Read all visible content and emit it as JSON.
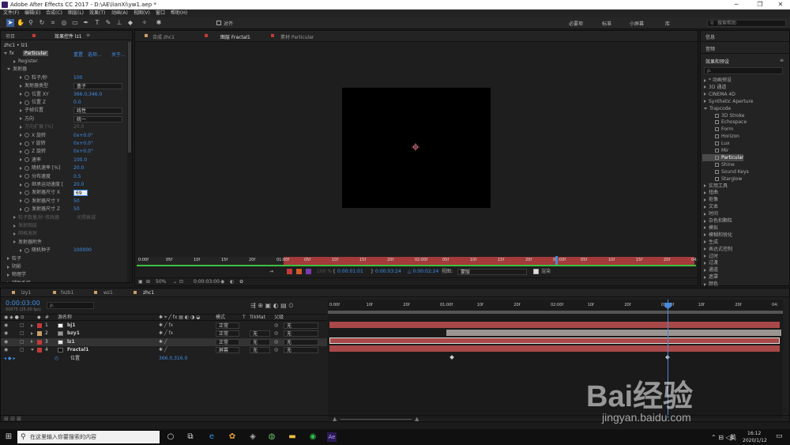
{
  "window": {
    "title": "Adobe After Effects CC 2017 - D:\\AE\\lianXi\\yw1.aep *",
    "min": "─",
    "max": "❐",
    "close": "✕"
  },
  "menu": [
    "文件(F)",
    "编辑(E)",
    "合成(C)",
    "图层(L)",
    "效果(T)",
    "动画(A)",
    "视图(V)",
    "窗口",
    "帮助(H)"
  ],
  "toolbar": {
    "align_label": "对齐",
    "workspaces": [
      "必要项",
      "标准",
      "小屏幕",
      "库"
    ],
    "search_placeholder": "搜索帮助"
  },
  "left_panel": {
    "tabs": [
      "项目",
      "效果控件 lz1"
    ],
    "breadcrumb": "zhc1 • lz1",
    "effect_name": "Particular",
    "effect_links": [
      "重置",
      "选项...",
      "关于..."
    ],
    "rows": [
      {
        "label": "Register",
        "val": "",
        "indent": 2,
        "dis": false
      },
      {
        "label": "发射器",
        "val": "",
        "indent": 1,
        "dis": false,
        "open": true
      },
      {
        "label": "粒子/秒",
        "val": "100",
        "indent": 3,
        "dis": false,
        "sw": true
      },
      {
        "label": "发射器类型",
        "val": "",
        "dd": "盒子",
        "indent": 3,
        "dis": false
      },
      {
        "label": "位置 XY",
        "val": "366.0,346.0",
        "indent": 3,
        "dis": false,
        "sw": true
      },
      {
        "label": "位置 Z",
        "val": "0.0",
        "indent": 3,
        "dis": false,
        "sw": true
      },
      {
        "label": "子帧位置",
        "val": "",
        "dd": "线性",
        "indent": 3,
        "dis": false
      },
      {
        "label": "方向",
        "val": "",
        "dd": "统一",
        "indent": 3,
        "dis": false
      },
      {
        "label": "方向扩展 [%]",
        "val": "20.0",
        "indent": 3,
        "dis": true
      },
      {
        "label": "X 旋转",
        "val": "0x+0.0°",
        "indent": 3,
        "dis": false,
        "sw": true
      },
      {
        "label": "Y 旋转",
        "val": "0x+0.0°",
        "indent": 3,
        "dis": false,
        "sw": true
      },
      {
        "label": "Z 旋转",
        "val": "0x+0.0°",
        "indent": 3,
        "dis": false,
        "sw": true
      },
      {
        "label": "速率",
        "val": "100.0",
        "indent": 3,
        "dis": false,
        "sw": true
      },
      {
        "label": "随机速率 [%]",
        "val": "20.0",
        "indent": 3,
        "dis": false,
        "sw": true
      },
      {
        "label": "分布速度",
        "val": "0.5",
        "indent": 3,
        "dis": false,
        "sw": true
      },
      {
        "label": "继承运动速度 [",
        "val": "20.0",
        "indent": 3,
        "dis": false,
        "sw": true
      },
      {
        "label": "发射器尺寸 X",
        "val": "",
        "edit": "69",
        "indent": 3,
        "dis": false,
        "sw": true
      },
      {
        "label": "发射器尺寸 Y",
        "val": "50",
        "indent": 3,
        "dis": false,
        "sw": true
      },
      {
        "label": "发射器尺寸 Z",
        "val": "50",
        "indent": 3,
        "dis": false,
        "sw": true
      },
      {
        "label": "粒子数量/秒 修改器",
        "val": "",
        "dd2": "光照衰减",
        "indent": 2,
        "dis": true
      },
      {
        "label": "发射图层",
        "val": "",
        "indent": 2,
        "dis": true
      },
      {
        "label": "网格发射",
        "val": "",
        "indent": 2,
        "dis": true
      },
      {
        "label": "发射器附件",
        "val": "",
        "indent": 2,
        "dis": false
      },
      {
        "label": "随机种子",
        "val": "100000",
        "indent": 3,
        "dis": false,
        "sw": true
      },
      {
        "label": "粒子",
        "val": "",
        "indent": 1,
        "dis": false
      },
      {
        "label": "阴影",
        "val": "",
        "indent": 1,
        "dis": false
      },
      {
        "label": "物理学",
        "val": "",
        "indent": 1,
        "dis": false
      },
      {
        "label": "辅助系统",
        "val": "",
        "indent": 1,
        "dis": false
      }
    ]
  },
  "viewer": {
    "tabs": [
      "合成 zhc1",
      "图层 Fractal1",
      "素材 Particular"
    ],
    "ruler_ticks": [
      "0:00f",
      "05f",
      "10f",
      "15f",
      "20f",
      "01:00f",
      "05f",
      "10f",
      "15f",
      "20f",
      "02:00f",
      "05f",
      "10f",
      "15f",
      "20f",
      "03:00f",
      "05f",
      "10f",
      "15f",
      "20f",
      "04:"
    ],
    "zoom": "50%",
    "timecode": "0:00:03:00",
    "in_point": "0:00:01:01",
    "out_point": "0:00:03:24",
    "duration": "△ 0:00:02:24",
    "view_label": "视图:",
    "view_value": "蒙版",
    "render_label": "渲染",
    "pct": "100 %"
  },
  "right_panel": {
    "items_top": [
      "信息",
      "音频"
    ],
    "fx_title": "效果和预设",
    "search_placeholder": "ρ.",
    "tree": [
      {
        "t": "* 动画预设",
        "lvl": 0,
        "open": false
      },
      {
        "t": "3D 通道",
        "lvl": 0,
        "open": false
      },
      {
        "t": "CINEMA 4D",
        "lvl": 0,
        "open": false
      },
      {
        "t": "Synthetic Aperture",
        "lvl": 0,
        "open": false
      },
      {
        "t": "Trapcode",
        "lvl": 0,
        "open": true
      },
      {
        "t": "3D Stroke",
        "lvl": 1
      },
      {
        "t": "Echospace",
        "lvl": 1
      },
      {
        "t": "Form",
        "lvl": 1
      },
      {
        "t": "Horizon",
        "lvl": 1
      },
      {
        "t": "Lux",
        "lvl": 1
      },
      {
        "t": "Mir",
        "lvl": 1
      },
      {
        "t": "Particular",
        "lvl": 1,
        "sel": true
      },
      {
        "t": "Shine",
        "lvl": 1
      },
      {
        "t": "Sound Keys",
        "lvl": 1
      },
      {
        "t": "Starglow",
        "lvl": 1
      },
      {
        "t": "实用工具",
        "lvl": 0,
        "open": false
      },
      {
        "t": "扭曲",
        "lvl": 0,
        "open": false
      },
      {
        "t": "抠像",
        "lvl": 0,
        "open": false
      },
      {
        "t": "文本",
        "lvl": 0,
        "open": false
      },
      {
        "t": "时间",
        "lvl": 0,
        "open": false
      },
      {
        "t": "杂色和颗粒",
        "lvl": 0,
        "open": false
      },
      {
        "t": "模拟",
        "lvl": 0,
        "open": false
      },
      {
        "t": "模糊和锐化",
        "lvl": 0,
        "open": false
      },
      {
        "t": "生成",
        "lvl": 0,
        "open": false
      },
      {
        "t": "表达式控制",
        "lvl": 0,
        "open": false
      },
      {
        "t": "过时",
        "lvl": 0,
        "open": false
      },
      {
        "t": "过渡",
        "lvl": 0,
        "open": false
      },
      {
        "t": "通道",
        "lvl": 0,
        "open": false
      },
      {
        "t": "遮罩",
        "lvl": 0,
        "open": false
      },
      {
        "t": "颜色",
        "lvl": 0,
        "open": false
      }
    ]
  },
  "timeline": {
    "tabs": [
      "lzy1",
      "fxzb1",
      "wz1",
      "zhc1"
    ],
    "timecode": "0:00:03:00",
    "fps": "00075 (25.00 fps)",
    "search_placeholder": "ρ.",
    "col_source": "源名称",
    "col_mode": "模式",
    "col_t": "T",
    "col_trkmat": "TrkMat",
    "col_parent": "父级",
    "ruler": [
      "0:00f",
      "10f",
      "20f",
      "01:00f",
      "10f",
      "20f",
      "02:00f",
      "10f",
      "20f",
      "03:00f",
      "10f",
      "20f",
      "04:"
    ],
    "layers": [
      {
        "num": "1",
        "name": "bj1",
        "color": "#c43a3a",
        "mode": "正常",
        "trk": "",
        "parent": "无",
        "swatch": "#ffffff"
      },
      {
        "num": "2",
        "name": "bzy1",
        "color": "#c8a06a",
        "mode": "正常",
        "trk": "无",
        "parent": "无",
        "swatch": "#9a9a9a"
      },
      {
        "num": "3",
        "name": "lz1",
        "color": "#c43a3a",
        "mode": "正常",
        "trk": "无",
        "parent": "无",
        "swatch": "#e8e8e8"
      },
      {
        "num": "4",
        "name": "Fractal1",
        "color": "#c43a3a",
        "mode": "屏幕",
        "trk": "无",
        "parent": "无",
        "swatch": "#111111"
      }
    ],
    "sub_label": "位置",
    "sub_value": "366.0,316.0"
  },
  "taskbar": {
    "search_text": "在这里输入你要搜索的内容",
    "time": "16:12",
    "date": "2020/1/12",
    "lang": "英"
  },
  "watermark": {
    "brand": "Bai经验",
    "url": "jingyan.baidu.com"
  }
}
